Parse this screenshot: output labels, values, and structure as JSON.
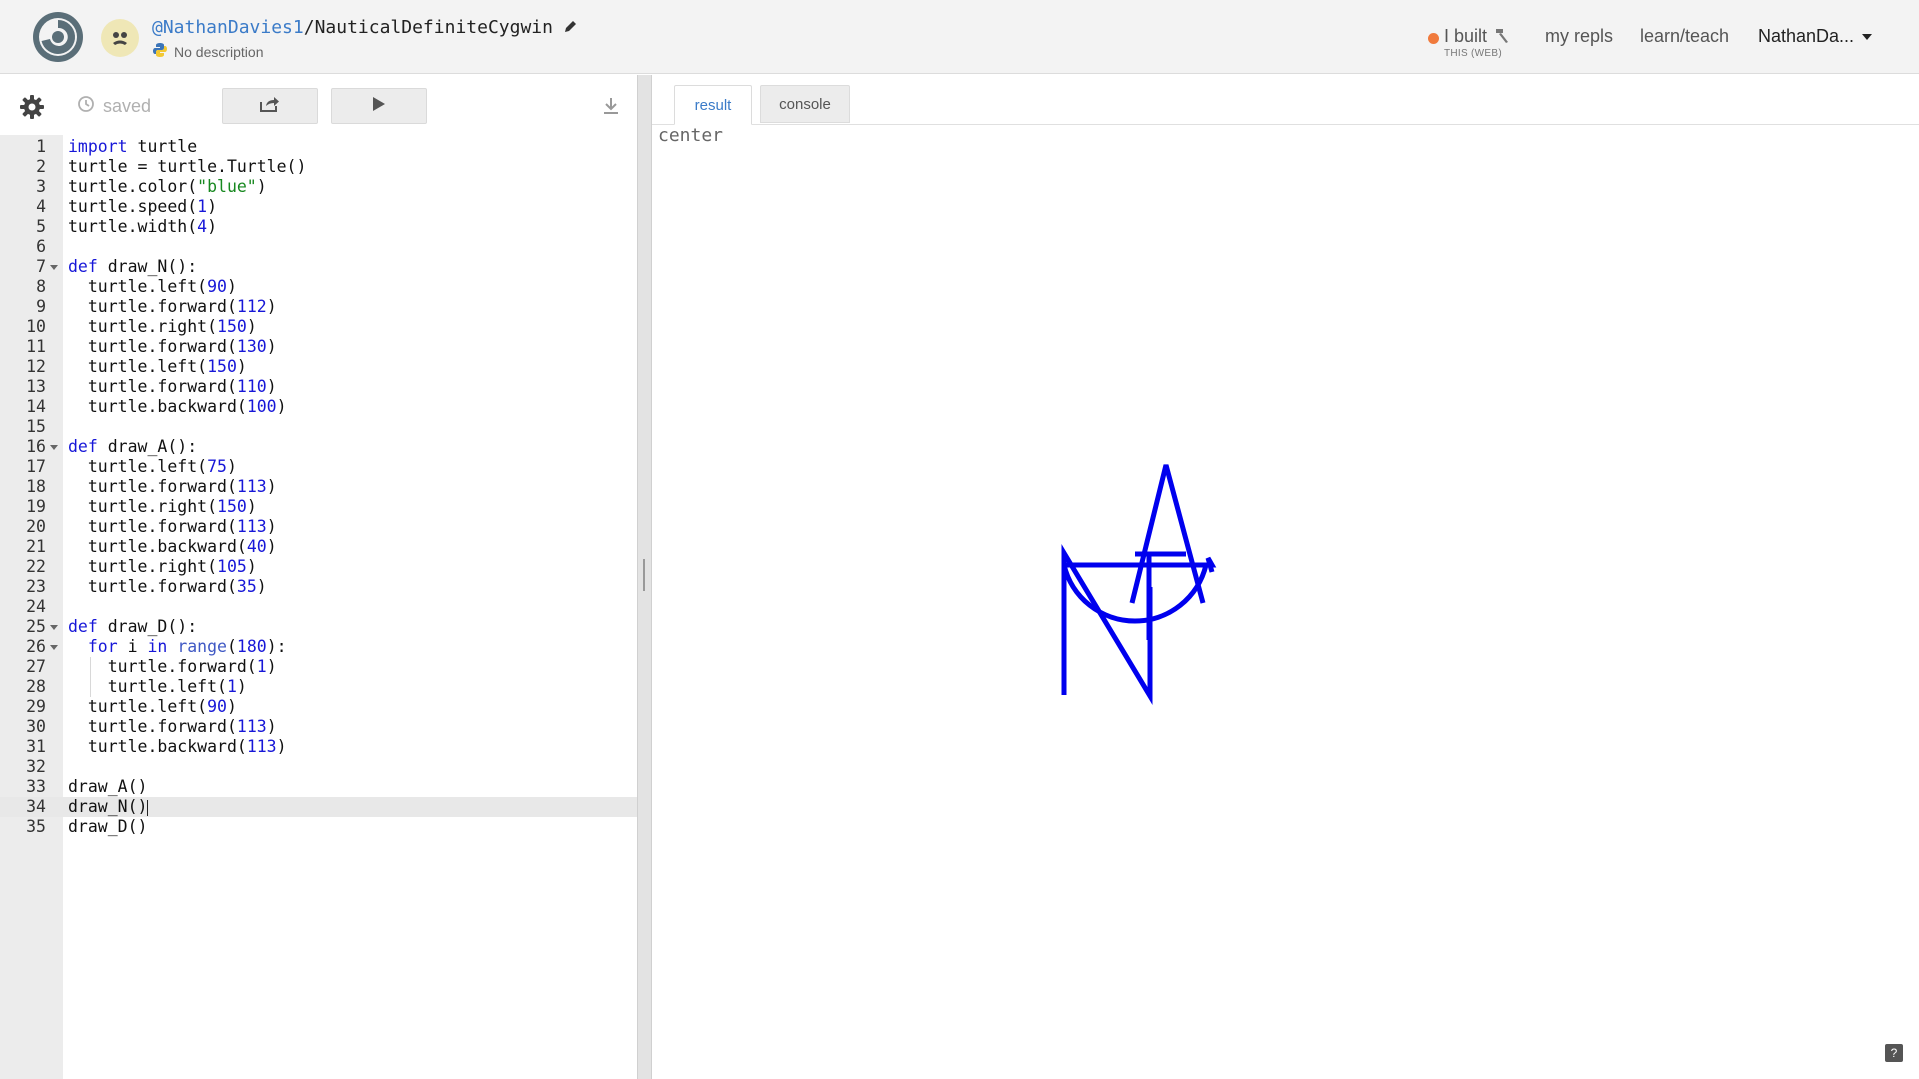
{
  "header": {
    "repl_user": "@NathanDavies1",
    "repl_separator": "/",
    "repl_name": "NauticalDefiniteCygwin",
    "description": "No description",
    "built_label": "I built",
    "built_sub": "THIS (WEB)",
    "nav_my_repls": "my repls",
    "nav_learn_teach": "learn/teach",
    "user_menu": "NathanDa...",
    "icons": [
      "replit-logo-icon",
      "avatar-icon",
      "pencil-icon",
      "python-icon",
      "hammer-icon",
      "chevron-down-icon"
    ],
    "accent_color": "#3b7bc8",
    "built_dot_color": "#f07a3c"
  },
  "toolbar": {
    "saved_label": "saved",
    "icons": [
      "gear-icon",
      "history-icon",
      "share-icon",
      "run-icon",
      "download-icon"
    ]
  },
  "editor": {
    "active_line": 34,
    "lines": [
      {
        "n": "1",
        "code": "import turtle"
      },
      {
        "n": "2",
        "code": "turtle = turtle.Turtle()"
      },
      {
        "n": "3",
        "code": "turtle.color(\"blue\")"
      },
      {
        "n": "4",
        "code": "turtle.speed(1)"
      },
      {
        "n": "5",
        "code": "turtle.width(4)"
      },
      {
        "n": "6",
        "code": ""
      },
      {
        "n": "7",
        "code": "def draw_N():"
      },
      {
        "n": "8",
        "code": "  turtle.left(90)"
      },
      {
        "n": "9",
        "code": "  turtle.forward(112)"
      },
      {
        "n": "10",
        "code": "  turtle.right(150)"
      },
      {
        "n": "11",
        "code": "  turtle.forward(130)"
      },
      {
        "n": "12",
        "code": "  turtle.left(150)"
      },
      {
        "n": "13",
        "code": "  turtle.forward(110)"
      },
      {
        "n": "14",
        "code": "  turtle.backward(100)"
      },
      {
        "n": "15",
        "code": ""
      },
      {
        "n": "16",
        "code": "def draw_A():"
      },
      {
        "n": "17",
        "code": "  turtle.left(75)"
      },
      {
        "n": "18",
        "code": "  turtle.forward(113)"
      },
      {
        "n": "19",
        "code": "  turtle.right(150)"
      },
      {
        "n": "20",
        "code": "  turtle.forward(113)"
      },
      {
        "n": "21",
        "code": "  turtle.backward(40)"
      },
      {
        "n": "22",
        "code": "  turtle.right(105)"
      },
      {
        "n": "23",
        "code": "  turtle.forward(35)"
      },
      {
        "n": "24",
        "code": ""
      },
      {
        "n": "25",
        "code": "def draw_D():"
      },
      {
        "n": "26",
        "code": "  for i in range(180):"
      },
      {
        "n": "27",
        "code": "    turtle.forward(1)"
      },
      {
        "n": "28",
        "code": "    turtle.left(1)"
      },
      {
        "n": "29",
        "code": "  turtle.left(90)"
      },
      {
        "n": "30",
        "code": "  turtle.forward(113)"
      },
      {
        "n": "31",
        "code": "  turtle.backward(113)"
      },
      {
        "n": "32",
        "code": ""
      },
      {
        "n": "33",
        "code": "draw_A()"
      },
      {
        "n": "34",
        "code": "draw_N()"
      },
      {
        "n": "35",
        "code": "draw_D()"
      }
    ],
    "keyword_color": "#1717d8",
    "string_color": "#17881f"
  },
  "result": {
    "tab_result": "result",
    "tab_console": "console",
    "canvas_label": "center",
    "help_label": "?",
    "drawing_color": "#0000ee"
  }
}
